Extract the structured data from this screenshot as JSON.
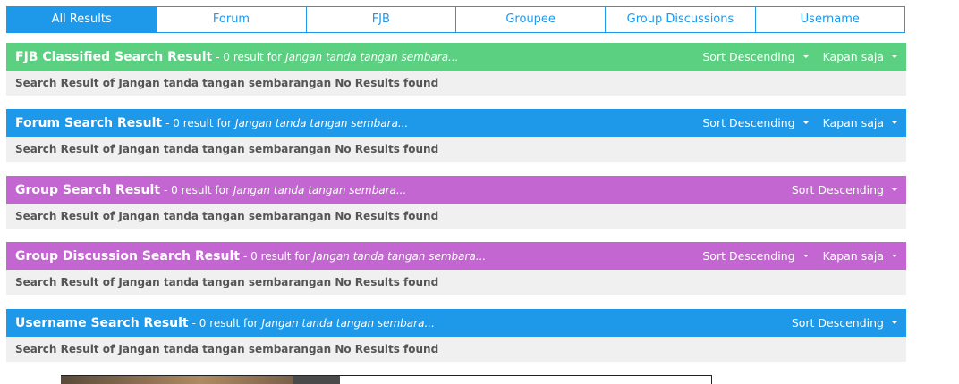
{
  "tabs": [
    {
      "label": "All Results",
      "active": true
    },
    {
      "label": "Forum",
      "active": false
    },
    {
      "label": "FJB",
      "active": false
    },
    {
      "label": "Groupee",
      "active": false
    },
    {
      "label": "Group Discussions",
      "active": false
    },
    {
      "label": "Username",
      "active": false
    }
  ],
  "sections": [
    {
      "title": "FJB Classified Search Result",
      "meta": "- 0 result for",
      "query": "Jangan tanda tangan sembara...",
      "sort_label": "Sort Descending",
      "time_label": "Kapan saja",
      "body": "Search Result of Jangan tanda tangan sembarangan No Results found",
      "color": "#5bd081"
    },
    {
      "title": "Forum Search Result",
      "meta": "- 0 result for",
      "query": "Jangan tanda tangan sembara...",
      "sort_label": "Sort Descending",
      "time_label": "Kapan saja",
      "body": "Search Result of Jangan tanda tangan sembarangan No Results found",
      "color": "#1e98e8"
    },
    {
      "title": "Group Search Result",
      "meta": "- 0 result for",
      "query": "Jangan tanda tangan sembara...",
      "sort_label": "Sort Descending",
      "body": "Search Result of Jangan tanda tangan sembarangan No Results found",
      "color": "#c466d1"
    },
    {
      "title": "Group Discussion Search Result",
      "meta": "- 0 result for",
      "query": "Jangan tanda tangan sembara...",
      "sort_label": "Sort Descending",
      "time_label": "Kapan saja",
      "body": "Search Result of Jangan tanda tangan sembarangan No Results found",
      "color": "#c466d1"
    },
    {
      "title": "Username Search Result",
      "meta": "- 0 result for",
      "query": "Jangan tanda tangan sembara...",
      "sort_label": "Sort Descending",
      "body": "Search Result of Jangan tanda tangan sembarangan No Results found",
      "color": "#1e98e8"
    }
  ]
}
